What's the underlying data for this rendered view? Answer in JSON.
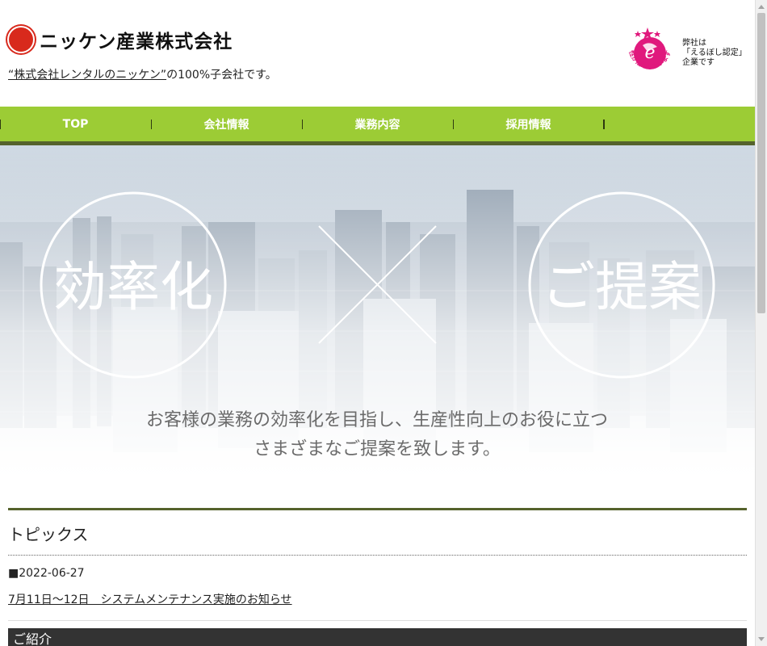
{
  "header": {
    "logo_text": "ニッケン産業株式会社",
    "subline_link": "“株式会社レンタルのニッケン”",
    "subline_rest": "の100%子会社です。",
    "eruboshi": {
      "arc_text": "女性が活躍しています！",
      "line1": "弊社は",
      "line2": "「えるぼし認定」",
      "line3": "企業です"
    }
  },
  "nav": {
    "items": [
      {
        "label": "TOP"
      },
      {
        "label": "会社情報"
      },
      {
        "label": "業務内容"
      },
      {
        "label": "採用情報"
      }
    ]
  },
  "hero": {
    "left_circle": "効率化",
    "right_circle": "ご提案",
    "caption_line1": "お客様の業務の効率化を目指し、生産性向上のお役に立つ",
    "caption_line2": "さまざまなご提案を致します。"
  },
  "topics": {
    "title": "トピックス",
    "items": [
      {
        "date": "■2022-06-27",
        "title": "7月11日〜12日　システムメンテナンス実施のお知らせ"
      }
    ]
  },
  "intro": {
    "title": "ご紹介"
  },
  "colors": {
    "nav_green": "#9ccc35",
    "nav_border": "#55622c",
    "logo_red": "#d8291c",
    "eruboshi_pink": "#e0197d"
  }
}
